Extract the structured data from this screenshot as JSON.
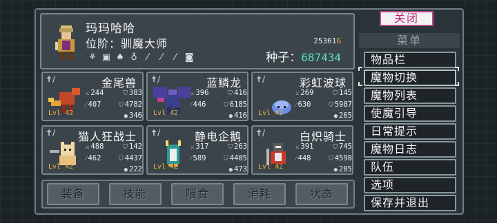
{
  "player": {
    "name": "玛玛哈哈",
    "rank_label": "位阶：驯魔大师",
    "gold": "25361",
    "gold_unit": "G",
    "seed_label": "种子：",
    "seed_value": "687434",
    "gear_icons": [
      "scroll-icon",
      "armor-icon",
      "mushroom-icon",
      "potion-icon",
      "feather-icon",
      "feather-icon",
      "feather-icon",
      "stone-icon"
    ]
  },
  "monsters": [
    {
      "name": "金尾兽",
      "level": "Lvl 42",
      "atk": "244",
      "def": "383",
      "matk": "407",
      "hp": "4782",
      "mp": "346"
    },
    {
      "name": "蓝鳞龙",
      "level": "Lvl 42",
      "atk": "396",
      "def": "416",
      "matk": "446",
      "hp": "6185",
      "mp": "416"
    },
    {
      "name": "彩虹波球",
      "level": "Lvl 42",
      "atk": "269",
      "def": "145",
      "matk": "630",
      "hp": "5987",
      "mp": "265"
    },
    {
      "name": "猫人狂战士",
      "level": "Lvl 42",
      "atk": "488",
      "def": "142",
      "matk": "462",
      "hp": "4437",
      "mp": "222"
    },
    {
      "name": "静电企鹅",
      "level": "Lvl 42",
      "atk": "317",
      "def": "263",
      "matk": "589",
      "hp": "4405",
      "mp": "473"
    },
    {
      "name": "白炽骑士",
      "level": "Lvl 42",
      "atk": "391",
      "def": "745",
      "matk": "448",
      "hp": "4598",
      "mp": "285"
    }
  ],
  "tabs": [
    "装备",
    "技能",
    "喂食",
    "消耗",
    "状态"
  ],
  "menu": {
    "close_label": "关闭",
    "title": "菜单",
    "items": [
      "物品栏",
      "魔物切换",
      "魔物列表",
      "使魔引导",
      "日常提示",
      "魔物日志",
      "队伍",
      "选项",
      "保存并退出"
    ],
    "selected_index": 1
  },
  "colors": {
    "panel": "#3b444a",
    "border": "#7a868c",
    "level_gold": "#e6b640",
    "seed_teal": "#5fdfc1",
    "close_pink": "#c0267a"
  }
}
